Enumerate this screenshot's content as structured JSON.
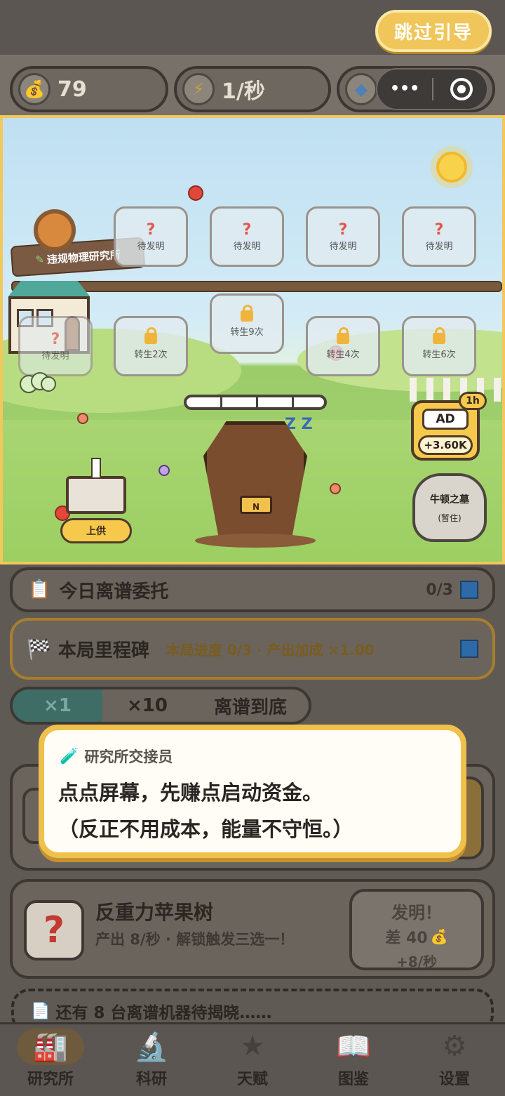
{
  "header": {
    "skip_label": "跳过引导"
  },
  "resources": {
    "coins": "79",
    "rate": "1/秒"
  },
  "scene": {
    "lab_name": "违规物理研究所",
    "top_slots": [
      {
        "label": "待发明"
      },
      {
        "label": "待发明"
      },
      {
        "label": "待发明"
      },
      {
        "label": "待发明"
      }
    ],
    "bottom_slots": [
      {
        "label": "待发明"
      },
      {
        "label": "转生2次"
      },
      {
        "label": "转生9次"
      },
      {
        "label": "转生4次"
      },
      {
        "label": "转生6次"
      }
    ],
    "question_mark": "?",
    "coffin_plate": "N",
    "sleep_z": "Z Z",
    "offering_label": "上供",
    "ad": {
      "badge": "1h",
      "label": "AD",
      "reward": "+3.60K"
    },
    "tomb": {
      "title": "牛顿之墓",
      "subtitle": "(暂住)"
    }
  },
  "commission": {
    "title": "今日离谱委托",
    "progress": "0/3"
  },
  "milestone": {
    "title": "本局里程碑",
    "detail": "本局进度 0/3 · 产出加成 ×1.00"
  },
  "multiplier_tabs": [
    {
      "label": "×1"
    },
    {
      "label": "×10"
    },
    {
      "label": "离谱到底"
    }
  ],
  "dialog": {
    "speaker": "研究所交接员",
    "line1": "点点屏幕，先赚点启动资金。",
    "line2": "（反正不用成本，能量不守恒。）"
  },
  "machine": {
    "name": "反重力苹果树",
    "desc": "产出 8/秒 · 解锁触发三选一！",
    "action": "发明！",
    "cost": "差 40",
    "gain": "+8/秒",
    "icon_text": "?"
  },
  "pending": {
    "text": "还有 8 台离谱机器待揭晓……"
  },
  "nav": [
    {
      "label": "研究所"
    },
    {
      "label": "科研"
    },
    {
      "label": "天赋"
    },
    {
      "label": "图鉴"
    },
    {
      "label": "设置"
    }
  ]
}
